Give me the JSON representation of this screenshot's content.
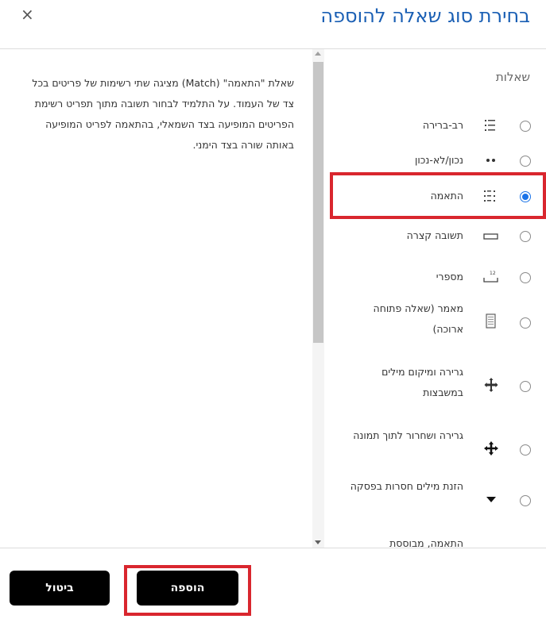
{
  "dialog": {
    "title": "בחירת סוג שאלה להוספה",
    "close_label": "×"
  },
  "description": "שאלת \"התאמה\" (Match) מציגה שתי רשימות של פריטים בכל צד של העמוד. על התלמיד לבחור תשובה מתוך תפריט רשימת הפריטים המופיעה בצד השמאלי, בהתאמה לפריט המופיעה באותה שורה בצד הימני.",
  "questions": {
    "section_title": "שאלות",
    "items": [
      {
        "label": "רב-ברירה",
        "icon": "multichoice-icon"
      },
      {
        "label": "נכון/לא-נכון",
        "icon": "truefalse-icon"
      },
      {
        "label": "התאמה",
        "icon": "match-icon",
        "selected": true
      },
      {
        "label": "תשובה קצרה",
        "icon": "shortanswer-icon"
      },
      {
        "label": "מספרי",
        "icon": "numerical-icon"
      },
      {
        "label": "מאמר (שאלה פתוחה ארוכה)",
        "icon": "essay-icon"
      },
      {
        "label": "גרירה ומיקום מילים במשבצות",
        "icon": "move-icon"
      },
      {
        "label": "גרירה ושחרור לתוך תמונה",
        "icon": "drag-drop-icon"
      },
      {
        "label": "הזנת מילים חסרות בפסקה",
        "icon": "dropdown-icon"
      },
      {
        "label": "התאמה, מבוססת",
        "icon": "match-based-icon"
      }
    ]
  },
  "footer": {
    "add_label": "הוספה",
    "cancel_label": "ביטול"
  }
}
